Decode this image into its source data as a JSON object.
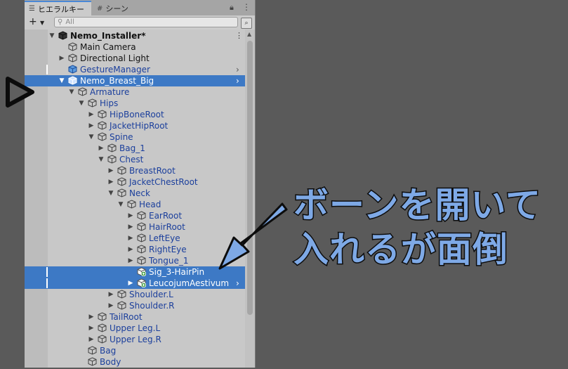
{
  "tabs": {
    "hierarchy": "ヒエラルキー",
    "scene": "シーン"
  },
  "search": {
    "placeholder": "All"
  },
  "rows": [
    {
      "label": "Nemo_Installer*"
    },
    {
      "label": "Main Camera"
    },
    {
      "label": "Directional Light"
    },
    {
      "label": "GestureManager"
    },
    {
      "label": "Nemo_Breast_Big"
    },
    {
      "label": "Armature"
    },
    {
      "label": "Hips"
    },
    {
      "label": "HipBoneRoot"
    },
    {
      "label": "JacketHipRoot"
    },
    {
      "label": "Spine"
    },
    {
      "label": "Bag_1"
    },
    {
      "label": "Chest"
    },
    {
      "label": "BreastRoot"
    },
    {
      "label": "JacketChestRoot"
    },
    {
      "label": "Neck"
    },
    {
      "label": "Head"
    },
    {
      "label": "EarRoot"
    },
    {
      "label": "HairRoot"
    },
    {
      "label": "LeftEye"
    },
    {
      "label": "RightEye"
    },
    {
      "label": "Tongue_1"
    },
    {
      "label": "Sig_3-HairPin"
    },
    {
      "label": "LeucojumAestivum"
    },
    {
      "label": "Shoulder.L"
    },
    {
      "label": "Shoulder.R"
    },
    {
      "label": "TailRoot"
    },
    {
      "label": "Upper Leg.L"
    },
    {
      "label": "Upper Leg.R"
    },
    {
      "label": "Bag"
    },
    {
      "label": "Body"
    }
  ],
  "annotation": {
    "line1": "ボーンを開いて",
    "line2": "入れるが面倒"
  },
  "colors": {
    "selection": "#3d79c5",
    "prefab_text": "#1b3f9c",
    "annotation_fill": "#7ea9e6"
  }
}
